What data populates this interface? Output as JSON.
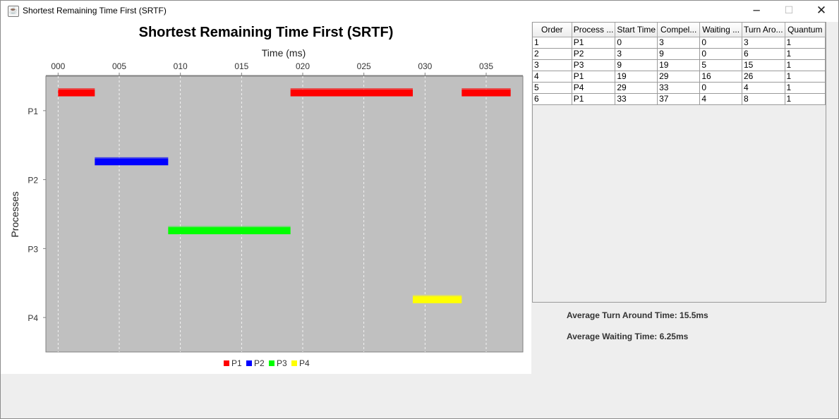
{
  "window": {
    "title": "Shortest Remaining Time First (SRTF)",
    "app_icon": "java-cup-icon",
    "controls": {
      "minimize": "─",
      "maximize": "☐",
      "close": "✕"
    }
  },
  "chart_data": {
    "type": "gantt",
    "title": "Shortest Remaining Time First (SRTF)",
    "xlabel": "Time (ms)",
    "ylabel": "Processes",
    "xlim": [
      -1,
      38
    ],
    "x_ticks": [
      "000",
      "005",
      "010",
      "015",
      "020",
      "025",
      "030",
      "035"
    ],
    "x_tick_values": [
      0,
      5,
      10,
      15,
      20,
      25,
      30,
      35
    ],
    "x_axis_position": "top",
    "categories": [
      "P1",
      "P2",
      "P3",
      "P4"
    ],
    "grid": true,
    "plot_background": "#c0c0c0",
    "legend_position": "bottom",
    "series": [
      {
        "name": "P1",
        "color": "#ff0000",
        "category": "P1",
        "intervals": [
          [
            0,
            3
          ],
          [
            19,
            29
          ],
          [
            33,
            37
          ]
        ]
      },
      {
        "name": "P2",
        "color": "#0000ff",
        "category": "P2",
        "intervals": [
          [
            3,
            9
          ]
        ]
      },
      {
        "name": "P3",
        "color": "#00ff00",
        "category": "P3",
        "intervals": [
          [
            9,
            19
          ]
        ]
      },
      {
        "name": "P4",
        "color": "#ffff00",
        "category": "P4",
        "intervals": [
          [
            29,
            33
          ]
        ]
      }
    ]
  },
  "table": {
    "columns": [
      "Order",
      "Process ...",
      "Start Time",
      "Compel...",
      "Waiting ...",
      "Turn Aro...",
      "Quantum"
    ],
    "rows": [
      [
        "1",
        "P1",
        "0",
        "3",
        "0",
        "3",
        "1"
      ],
      [
        "2",
        "P2",
        "3",
        "9",
        "0",
        "6",
        "1"
      ],
      [
        "3",
        "P3",
        "9",
        "19",
        "5",
        "15",
        "1"
      ],
      [
        "4",
        "P1",
        "19",
        "29",
        "16",
        "26",
        "1"
      ],
      [
        "5",
        "P4",
        "29",
        "33",
        "0",
        "4",
        "1"
      ],
      [
        "6",
        "P1",
        "33",
        "37",
        "4",
        "8",
        "1"
      ]
    ]
  },
  "stats": {
    "avg_turnaround": "Average Turn Around Time: 15.5ms",
    "avg_waiting": "Average Waiting Time: 6.25ms"
  }
}
